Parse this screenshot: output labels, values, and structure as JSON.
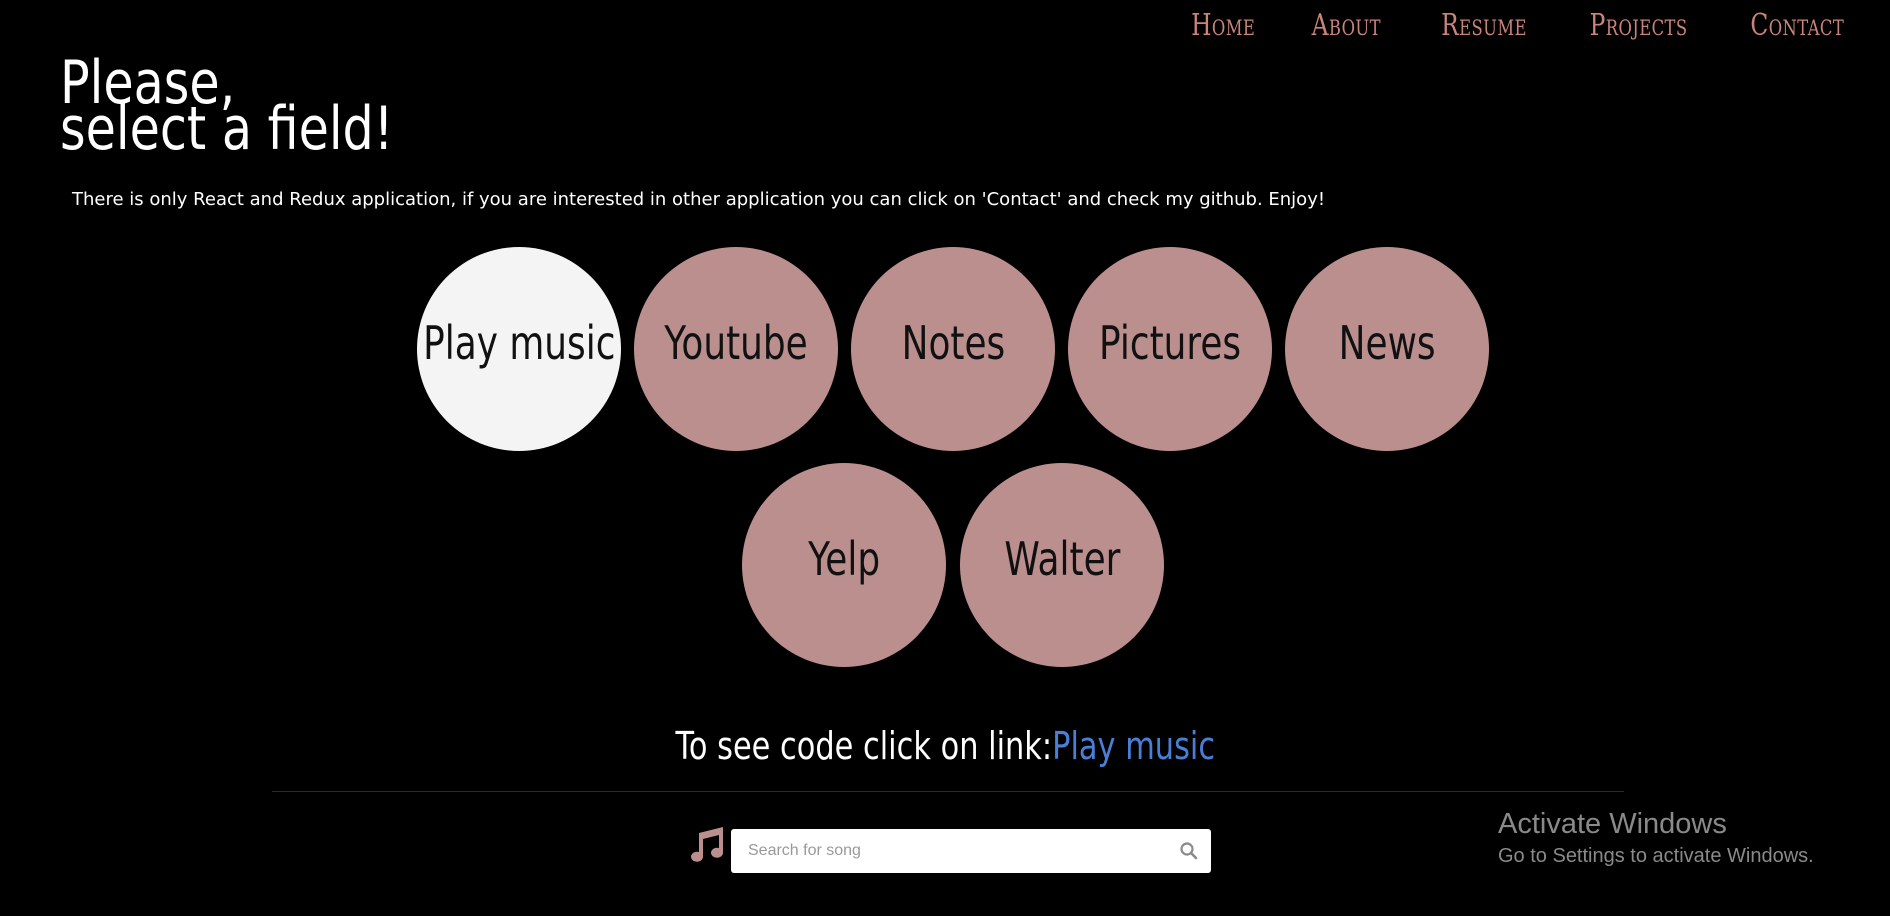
{
  "nav": {
    "items": [
      {
        "label": "Home"
      },
      {
        "label": "About"
      },
      {
        "label": "Resume"
      },
      {
        "label": "Projects"
      },
      {
        "label": "Contact"
      }
    ]
  },
  "header": {
    "title_line1": "Please,",
    "title_line2": "select a field!",
    "subtitle": "There is only React and Redux application, if you are interested in other application you can click on 'Contact' and check my github. Enjoy!"
  },
  "fields": [
    {
      "label": "Play music",
      "active": true
    },
    {
      "label": "Youtube",
      "active": false
    },
    {
      "label": "Notes",
      "active": false
    },
    {
      "label": "Pictures",
      "active": false
    },
    {
      "label": "News",
      "active": false
    },
    {
      "label": "Yelp",
      "active": false
    },
    {
      "label": "Walter",
      "active": false
    }
  ],
  "code_link": {
    "prefix": "To see code click on link:",
    "link_text": "Play music"
  },
  "search": {
    "icon": "music-note-icon",
    "placeholder": "Search for song",
    "value": ""
  },
  "watermark": {
    "title": "Activate Windows",
    "subtitle": "Go to Settings to activate Windows."
  },
  "colors": {
    "background": "#000000",
    "accent": "#c9857a",
    "circle": "#bc8f8f",
    "circle_active": "#f4f4f4",
    "link": "#4a7fd8"
  }
}
